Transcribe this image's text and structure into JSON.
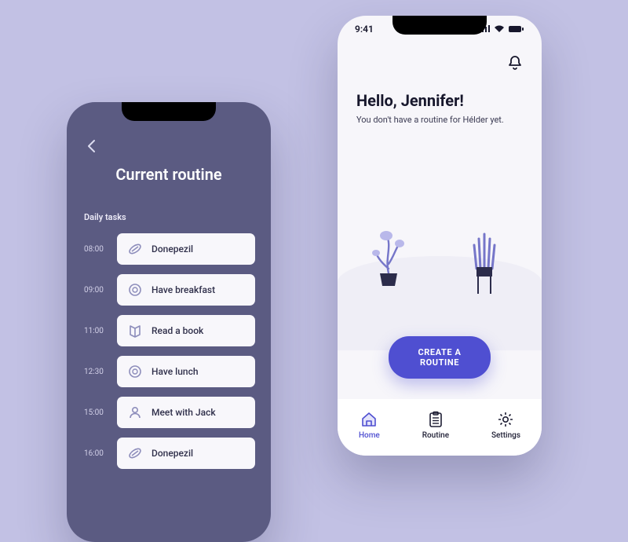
{
  "routine_screen": {
    "title": "Current routine",
    "section": "Daily tasks",
    "tasks": [
      {
        "time": "08:00",
        "icon": "pill-icon",
        "label": "Donepezil"
      },
      {
        "time": "09:00",
        "icon": "plate-icon",
        "label": "Have breakfast"
      },
      {
        "time": "11:00",
        "icon": "book-icon",
        "label": "Read a book"
      },
      {
        "time": "12:30",
        "icon": "plate-icon",
        "label": "Have lunch"
      },
      {
        "time": "15:00",
        "icon": "person-icon",
        "label": "Meet with Jack"
      },
      {
        "time": "16:00",
        "icon": "pill-icon",
        "label": "Donepezil"
      }
    ]
  },
  "home_screen": {
    "status_time": "9:41",
    "greeting": "Hello, Jennifer!",
    "subtext": "You don't have a routine for Hélder yet.",
    "cta_label": "CREATE A ROUTINE",
    "nav": [
      {
        "icon": "home-icon",
        "label": "Home",
        "active": true
      },
      {
        "icon": "clipboard-icon",
        "label": "Routine",
        "active": false
      },
      {
        "icon": "gear-icon",
        "label": "Settings",
        "active": false
      }
    ]
  },
  "colors": {
    "background": "#c2c1e4",
    "routine_bg": "#5b5b82",
    "home_bg": "#f7f6fa",
    "accent": "#4f4fd1"
  }
}
